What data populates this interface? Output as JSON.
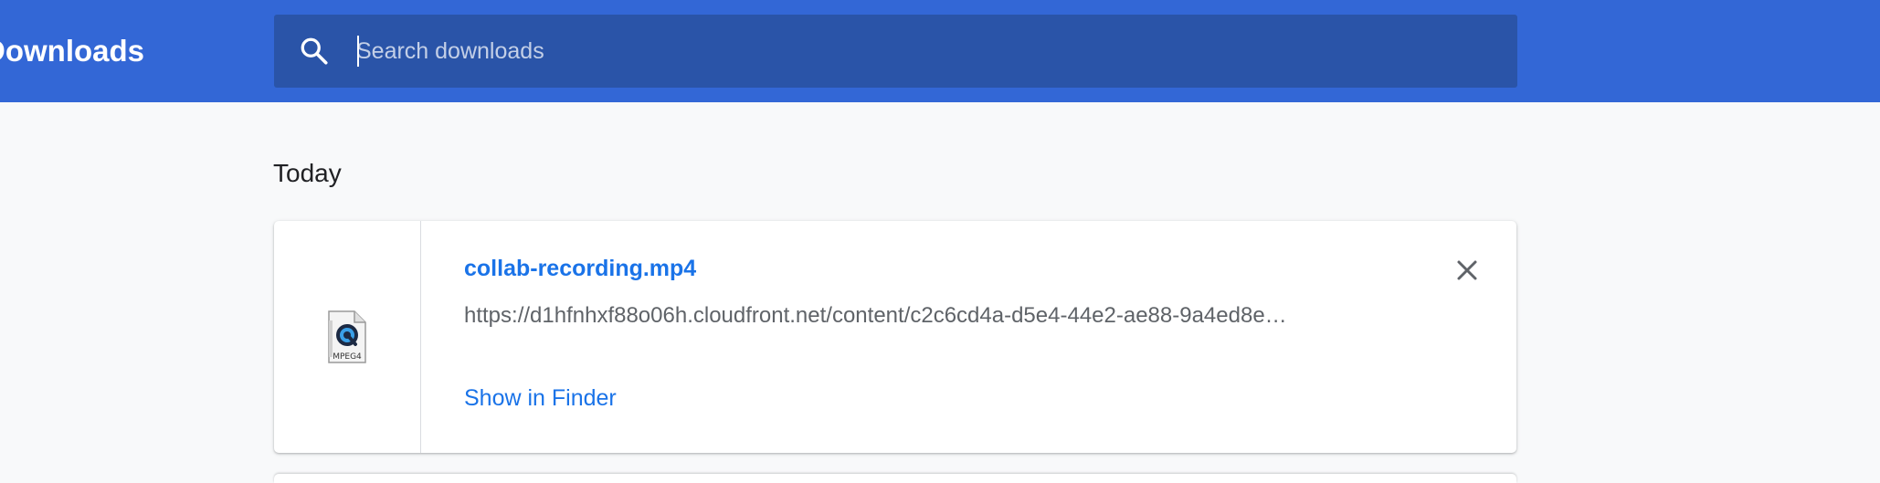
{
  "header": {
    "title": "Downloads",
    "search": {
      "placeholder": "Search downloads",
      "value": ""
    }
  },
  "sections": [
    {
      "date": "Today",
      "items": [
        {
          "file_name": "collab-recording.mp4",
          "url": "https://d1hfnhxf88o06h.cloudfront.net/content/c2c6cd4a-d5e4-44e2-ae88-9a4ed8e…",
          "action_label": "Show in Finder",
          "icon": "quicktime-mpeg4-file-icon",
          "icon_badge": "MPEG4"
        }
      ]
    }
  ],
  "colors": {
    "header_bg": "#3367d6",
    "search_bg": "#2a54a8",
    "link": "#1a73e8"
  }
}
